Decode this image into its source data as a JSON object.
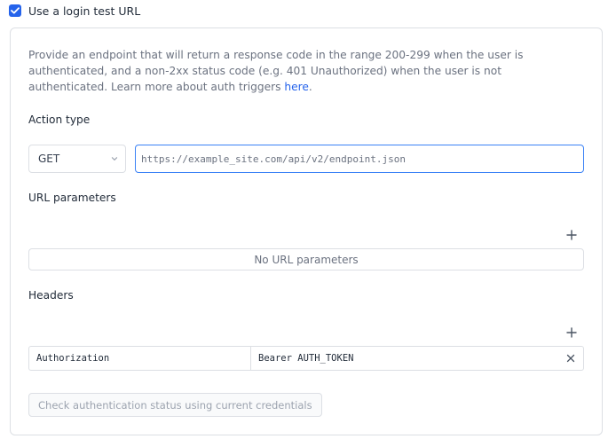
{
  "checkbox": {
    "checked": true,
    "label": "Use a login test URL"
  },
  "description": {
    "text": "Provide an endpoint that will return a response code in the range 200-299 when the user is authenticated, and a non-2xx status code (e.g. 401 Unauthorized) when the user is not authenticated. Learn more about auth triggers ",
    "link_text": "here",
    "trailing": "."
  },
  "action_type": {
    "label": "Action type",
    "selected": "GET",
    "url_placeholder": "https://example_site.com/api/v2/endpoint.json",
    "url_value": ""
  },
  "url_parameters": {
    "label": "URL parameters",
    "add_icon": "plus-icon",
    "empty_text": "No URL parameters"
  },
  "headers": {
    "label": "Headers",
    "add_icon": "plus-icon",
    "rows": [
      {
        "key": "Authorization",
        "value": "Bearer AUTH_TOKEN",
        "remove_icon": "close-icon"
      }
    ]
  },
  "check_button": {
    "label": "Check authentication status using current credentials",
    "disabled": true
  },
  "colors": {
    "accent": "#2563eb",
    "border": "#dcdfe4",
    "muted_text": "#6b7280",
    "disabled_text": "#9ca3af"
  }
}
